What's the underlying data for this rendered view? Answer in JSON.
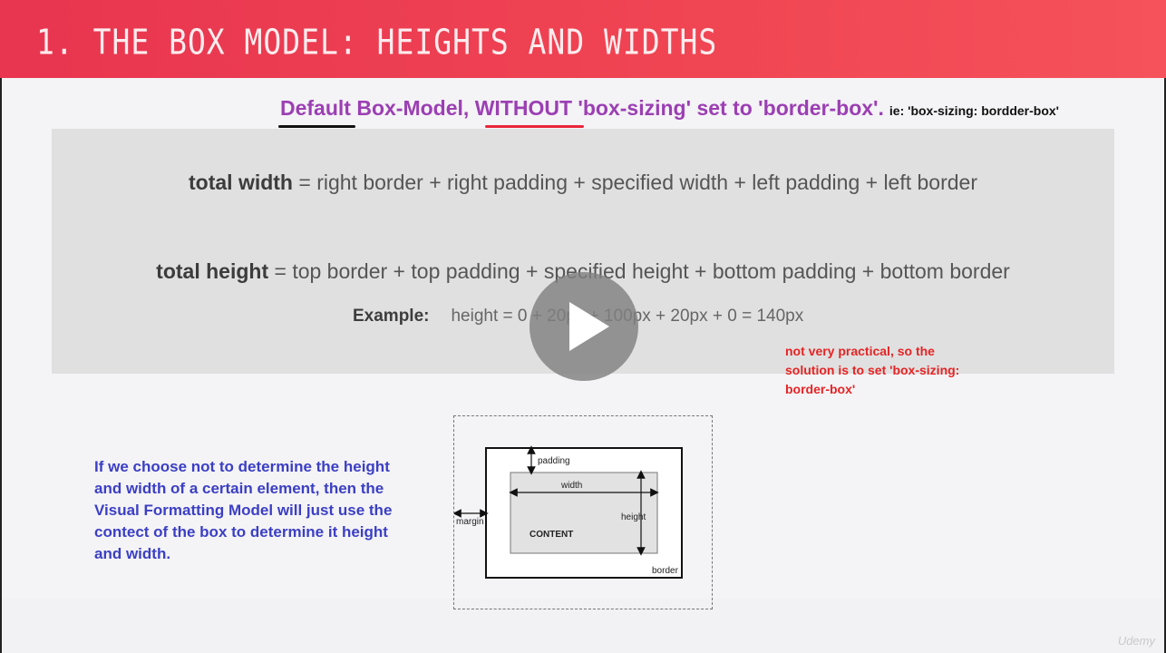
{
  "header": {
    "title": "1. THE BOX MODEL: HEIGHTS AND WIDTHS"
  },
  "subtitle": {
    "word_default": "Default",
    "mid": " Box-Model, ",
    "word_without": "WITHOUT",
    "rest": " 'box-sizing' set to 'border-box'.",
    "tail": "ie: 'box-sizing: bordder-box'"
  },
  "formulas": {
    "width_label": "total width",
    "width_expr": " = right border + right padding + specified width + left padding + left border",
    "height_label": "total height",
    "height_expr": " = top border + top padding + specified height + bottom padding + bottom border",
    "example_label": "Example:",
    "example_expr": "height = 0 + 20px + 100px + 20px + 0 = 140px"
  },
  "notes": {
    "red": "not very practical, so the solution is to set 'box-sizing: border-box'",
    "blue": "If we choose not to determine the height and width of a certain element, then the Visual Formatting Model will just use the contect of the box to determine it height and width."
  },
  "diagram": {
    "padding": "padding",
    "width": "width",
    "height": "height",
    "margin": "margin",
    "content": "CONTENT",
    "border": "border"
  },
  "watermark": "Udemy",
  "colors": {
    "header_start": "#e83550",
    "header_end": "#f5525b",
    "subtitle_purple": "#9b3fb3",
    "note_red": "#e52424",
    "note_blue": "#3b3fc4",
    "underline_red": "#e8263a"
  },
  "icons": {
    "play": "play-icon"
  }
}
